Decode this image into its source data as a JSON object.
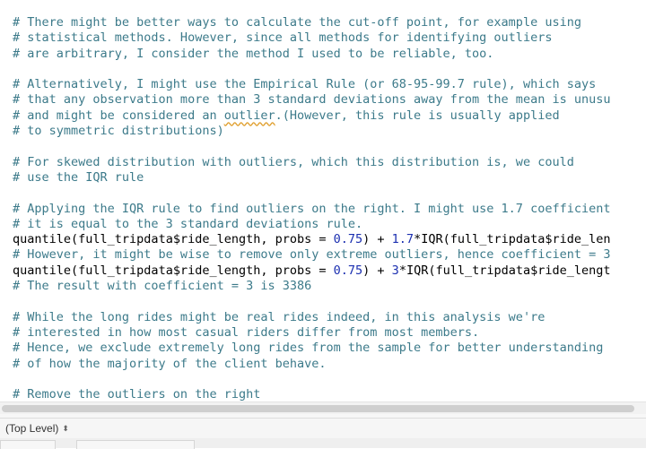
{
  "editor": {
    "lines": [
      [
        {
          "t": "# There might be better ways to calculate the cut-off point, for example using",
          "c": "comment"
        }
      ],
      [
        {
          "t": "# statistical methods. However, since all methods for identifying outliers",
          "c": "comment"
        }
      ],
      [
        {
          "t": "# are arbitrary, I consider the method I used to be reliable, too.",
          "c": "comment"
        }
      ],
      [],
      [
        {
          "t": "# Alternatively, I might use the Empirical Rule (or 68-95-99.7 rule), which says",
          "c": "comment"
        }
      ],
      [
        {
          "t": "# that any observation more than 3 standard deviations away from the mean is unusu",
          "c": "comment"
        }
      ],
      [
        {
          "t": "# and might be considered an ",
          "c": "comment"
        },
        {
          "t": "outlier",
          "c": "comment spell"
        },
        {
          "t": ".(However, this rule is usually applied",
          "c": "comment"
        }
      ],
      [
        {
          "t": "# to symmetric distributions)",
          "c": "comment"
        }
      ],
      [],
      [
        {
          "t": "# For skewed distribution with outliers, which this distribution is, we could",
          "c": "comment"
        }
      ],
      [
        {
          "t": "# use the IQR rule",
          "c": "comment"
        }
      ],
      [],
      [
        {
          "t": "# Applying the IQR rule to find outliers on the right. I might use 1.7 coefficient",
          "c": "comment"
        }
      ],
      [
        {
          "t": "# it is equal to the 3 standard deviations rule.",
          "c": "comment"
        }
      ],
      [
        {
          "t": "quantile",
          "c": "fn"
        },
        {
          "t": "(full_tripdata$ride_length, probs = ",
          "c": "plain"
        },
        {
          "t": "0.75",
          "c": "num"
        },
        {
          "t": ") + ",
          "c": "plain"
        },
        {
          "t": "1.7",
          "c": "num"
        },
        {
          "t": "*",
          "c": "plain"
        },
        {
          "t": "IQR",
          "c": "fn"
        },
        {
          "t": "(full_tripdata$ride_len",
          "c": "plain"
        }
      ],
      [
        {
          "t": "# However, it might be wise to remove only extreme outliers, hence coefficient = 3",
          "c": "comment"
        }
      ],
      [
        {
          "t": "quantile",
          "c": "fn"
        },
        {
          "t": "(full_tripdata$ride_length, probs = ",
          "c": "plain"
        },
        {
          "t": "0.75",
          "c": "num"
        },
        {
          "t": ") + ",
          "c": "plain"
        },
        {
          "t": "3",
          "c": "num"
        },
        {
          "t": "*",
          "c": "plain"
        },
        {
          "t": "IQR",
          "c": "fn"
        },
        {
          "t": "(full_tripdata$ride_lengt",
          "c": "plain"
        }
      ],
      [
        {
          "t": "# The result with coefficient = 3 is 3386",
          "c": "comment"
        }
      ],
      [],
      [
        {
          "t": "# While the long rides might be real rides indeed, in this analysis we're",
          "c": "comment"
        }
      ],
      [
        {
          "t": "# interested in how most casual riders differ from most members.",
          "c": "comment"
        }
      ],
      [
        {
          "t": "# Hence, we exclude extremely long rides from the sample for better understanding",
          "c": "comment"
        }
      ],
      [
        {
          "t": "# of how the majority of the client behave.",
          "c": "comment"
        }
      ],
      [],
      [
        {
          "t": "# Remove the outliers on the right",
          "c": "comment"
        }
      ]
    ]
  },
  "statusbar": {
    "scope_label": "(Top Level)",
    "scope_icon": "updown-chevron-icon"
  },
  "colors": {
    "comment": "#3c7a8a",
    "number": "#1b2fb0",
    "spellcheck": "#e0a030"
  }
}
